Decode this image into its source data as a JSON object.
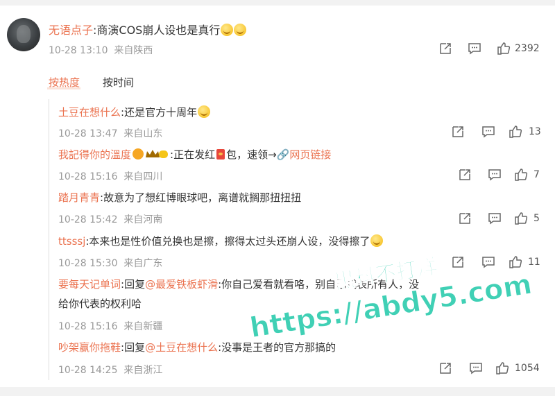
{
  "main_comment": {
    "username": "无语点子",
    "text": ":商演COS崩人设也是真行",
    "time": "10-28 13:10",
    "location": "来自陕西",
    "likes": "2392"
  },
  "sort_tabs": {
    "hot": "按热度",
    "time": "按时间"
  },
  "replies": [
    {
      "username": "土豆在想什么",
      "text": ":还是官方十周年",
      "time": "10-28 13:47",
      "location": "来自山东",
      "likes": "13"
    },
    {
      "username": "我記得你的溫度",
      "text": ":正在发红",
      "text2": "包，速领→",
      "link": "网页链接",
      "time": "10-28 15:16",
      "location": "来自四川",
      "likes": "7"
    },
    {
      "username": "踏月青青",
      "text": ":故意为了想红博眼球吧，离谱就搁那扭扭扭",
      "time": "10-28 15:42",
      "location": "来自河南",
      "likes": "5"
    },
    {
      "username": "ttsssj",
      "text": ":本来也是性价值兑换也是擦，擦得太过头还崩人设，没得擦了",
      "time": "10-28 15:30",
      "location": "来自广东",
      "likes": "11"
    },
    {
      "username": "要每天记单词",
      "reply_prefix": ":回复",
      "reply_to": "@最爱铁板虾滑",
      "text": ":你自己爱看就看咯，别自己代表所有人，没",
      "text_line2": "给你代表的权利哈",
      "time": "10-28 15:16",
      "location": "来自新疆"
    },
    {
      "username": "吵架赢你拖鞋",
      "reply_prefix": ":回复",
      "reply_to": "@土豆在想什么",
      "text": ":没事是王者的官方那搞的",
      "time": "10-28 14:25",
      "location": "来自浙江",
      "likes": "1054"
    }
  ],
  "watermark": {
    "line1": "黑料不打烊",
    "line2": "https://abdy5.com"
  },
  "colors": {
    "accent": "#eb7350",
    "watermark": "#1fc8a8"
  }
}
